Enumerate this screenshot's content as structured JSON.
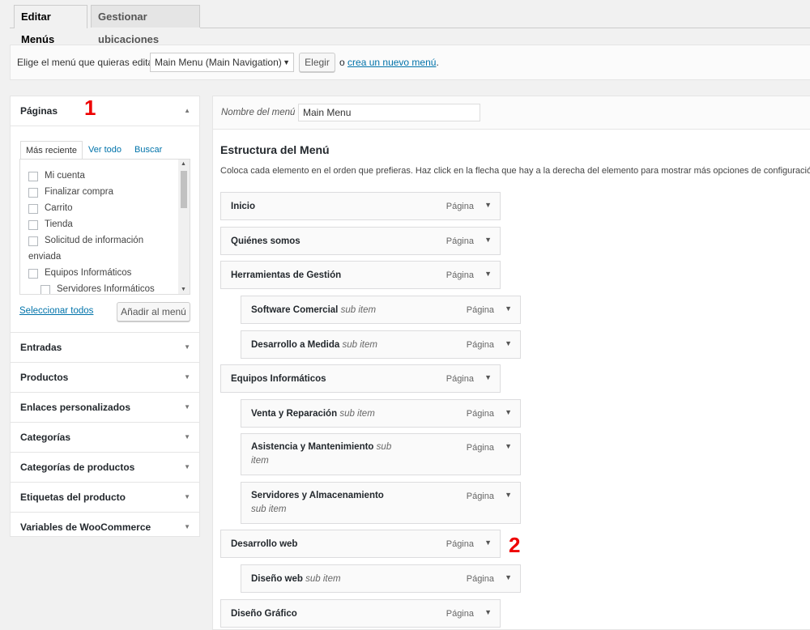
{
  "tabs": [
    {
      "label": "Editar Menús",
      "active": true
    },
    {
      "label": "Gestionar ubicaciones",
      "active": false
    }
  ],
  "menu_select": {
    "label": "Elige el menú que quieras editar:",
    "value": "Main Menu (Main Navigation)",
    "button": "Elegir",
    "or_text": "o",
    "create_link": "crea un nuevo menú",
    "period": "."
  },
  "left_panel": {
    "pages": {
      "title": "Páginas",
      "tabs": [
        "Más reciente",
        "Ver todo",
        "Buscar"
      ],
      "items": [
        "Mi cuenta",
        "Finalizar compra",
        "Carrito",
        "Tienda",
        "Solicitud de información",
        "enviada",
        "Equipos Informáticos",
        "Servidores Informáticos"
      ],
      "select_all": "Seleccionar todos",
      "add_button": "Añadir al menú"
    },
    "sections": [
      "Entradas",
      "Productos",
      "Enlaces personalizados",
      "Categorías",
      "Categorías de productos",
      "Etiquetas del producto",
      "Variables de WooCommerce"
    ]
  },
  "annotations": [
    "1",
    "2"
  ],
  "menu_editor": {
    "name_label": "Nombre del menú",
    "name_value": "Main Menu",
    "structure_title": "Estructura del Menú",
    "structure_desc": "Coloca cada elemento en el orden que prefieras. Haz click en la flecha que hay a la derecha del elemento para mostrar más opciones de configuración.",
    "type_label": "Página",
    "sub_label": "sub item",
    "items": [
      {
        "title": "Inicio",
        "depth": 0
      },
      {
        "title": "Quiénes somos",
        "depth": 0
      },
      {
        "title": "Herramientas de Gestión",
        "depth": 0
      },
      {
        "title": "Software Comercial",
        "depth": 1
      },
      {
        "title": "Desarrollo a Medida",
        "depth": 1
      },
      {
        "title": "Equipos Informáticos",
        "depth": 0
      },
      {
        "title": "Venta y Reparación",
        "depth": 1
      },
      {
        "title": "Asistencia y Mantenimiento",
        "depth": 1
      },
      {
        "title": "Servidores y Almacenamiento",
        "depth": 1
      },
      {
        "title": "Desarrollo web",
        "depth": 0
      },
      {
        "title": "Diseño web",
        "depth": 1
      },
      {
        "title": "Diseño Gráfico",
        "depth": 0
      }
    ]
  }
}
